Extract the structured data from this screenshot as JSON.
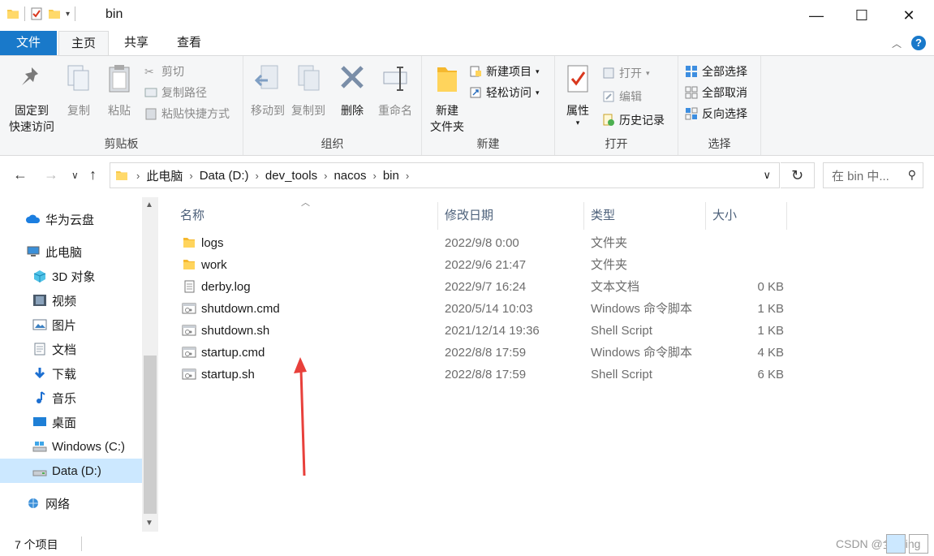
{
  "window": {
    "title": "bin",
    "minimize_label": "—",
    "maximize_label": "☐",
    "close_label": "✕"
  },
  "ribbon_tabs": {
    "file": "文件",
    "home": "主页",
    "share": "共享",
    "view": "查看"
  },
  "ribbon": {
    "clipboard": {
      "group_label": "剪贴板",
      "pin_line1": "固定到",
      "pin_line2": "快速访问",
      "copy": "复制",
      "paste": "粘贴",
      "cut": "剪切",
      "copy_path": "复制路径",
      "paste_shortcut": "粘贴快捷方式"
    },
    "organize": {
      "group_label": "组织",
      "move_to": "移动到",
      "copy_to": "复制到",
      "delete": "删除",
      "rename": "重命名"
    },
    "new": {
      "group_label": "新建",
      "new_folder_line1": "新建",
      "new_folder_line2": "文件夹",
      "new_item": "新建项目",
      "easy_access": "轻松访问"
    },
    "open": {
      "group_label": "打开",
      "properties": "属性",
      "open": "打开",
      "edit": "编辑",
      "history": "历史记录"
    },
    "select": {
      "group_label": "选择",
      "select_all": "全部选择",
      "select_none": "全部取消",
      "invert": "反向选择"
    }
  },
  "address": {
    "breadcrumbs": [
      "此电脑",
      "Data (D:)",
      "dev_tools",
      "nacos",
      "bin"
    ],
    "search_placeholder": "在 bin 中..."
  },
  "nav_pane": {
    "items": [
      {
        "label": "华为云盘",
        "icon": "cloud-icon"
      },
      {
        "label": "此电脑",
        "icon": "computer-icon"
      },
      {
        "label": "3D 对象",
        "icon": "cube-icon"
      },
      {
        "label": "视频",
        "icon": "video-icon"
      },
      {
        "label": "图片",
        "icon": "picture-icon"
      },
      {
        "label": "文档",
        "icon": "document-icon"
      },
      {
        "label": "下载",
        "icon": "download-icon"
      },
      {
        "label": "音乐",
        "icon": "music-icon"
      },
      {
        "label": "桌面",
        "icon": "desktop-icon"
      },
      {
        "label": "Windows (C:)",
        "icon": "drive-icon"
      },
      {
        "label": "Data (D:)",
        "icon": "drive-icon",
        "selected": true
      },
      {
        "label": "网络",
        "icon": "network-icon"
      }
    ]
  },
  "file_list": {
    "columns": {
      "name": "名称",
      "date": "修改日期",
      "type": "类型",
      "size": "大小"
    },
    "rows": [
      {
        "name": "logs",
        "date": "2022/9/8 0:00",
        "type": "文件夹",
        "size": "",
        "icon": "folder-icon"
      },
      {
        "name": "work",
        "date": "2022/9/6 21:47",
        "type": "文件夹",
        "size": "",
        "icon": "folder-icon"
      },
      {
        "name": "derby.log",
        "date": "2022/9/7 16:24",
        "type": "文本文档",
        "size": "0 KB",
        "icon": "text-file-icon"
      },
      {
        "name": "shutdown.cmd",
        "date": "2020/5/14 10:03",
        "type": "Windows 命令脚本",
        "size": "1 KB",
        "icon": "script-file-icon"
      },
      {
        "name": "shutdown.sh",
        "date": "2021/12/14 19:36",
        "type": "Shell Script",
        "size": "1 KB",
        "icon": "script-file-icon"
      },
      {
        "name": "startup.cmd",
        "date": "2022/8/8 17:59",
        "type": "Windows 命令脚本",
        "size": "4 KB",
        "icon": "script-file-icon"
      },
      {
        "name": "startup.sh",
        "date": "2022/8/8 17:59",
        "type": "Shell Script",
        "size": "6 KB",
        "icon": "script-file-icon"
      }
    ]
  },
  "status": {
    "item_count": "7 个项目",
    "watermark": "CSDN @全栈ing"
  },
  "colors": {
    "accent": "#1979ca",
    "selected_bg": "#cce8ff",
    "annotation_arrow": "#e8403b"
  }
}
